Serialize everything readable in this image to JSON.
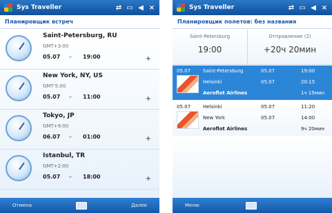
{
  "left": {
    "app_title": "Sys Traveller",
    "header": "Планировщик встреч",
    "cities": [
      {
        "name": "Saint-Petersburg, RU",
        "gmt": "GMT+3:00",
        "date": "05.07",
        "sep": "–",
        "time": "19:00",
        "action": "+"
      },
      {
        "name": "New York, NY, US",
        "gmt": "GMT-5:00",
        "date": "05.07",
        "sep": "–",
        "time": "11:00",
        "action": "+"
      },
      {
        "name": "Tokyo, JP",
        "gmt": "GMT+9:00",
        "date": "06.07",
        "sep": "–",
        "time": "01:00",
        "action": "+"
      },
      {
        "name": "Istanbul, TR",
        "gmt": "GMT+2:00",
        "date": "05.07",
        "sep": "–",
        "time": "18:00",
        "action": "+"
      }
    ],
    "menu": {
      "left": "Отмена",
      "right": "Далее"
    }
  },
  "right": {
    "app_title": "Sys Traveller",
    "header": "Планировщик полетов: без названия",
    "from": {
      "label": "Saint-Petersburg",
      "value": "19:00"
    },
    "to": {
      "label": "Отправление (2)",
      "value": "+20ч 20мин"
    },
    "flights": [
      {
        "selected": true,
        "date": "05.07",
        "legs": [
          {
            "city": "Saint-Petersburg",
            "date": "05.07",
            "time": "19:00"
          },
          {
            "city": "Helsinki",
            "date": "05.07",
            "time": "20:15"
          }
        ],
        "airline": "Aeroflot Airlines",
        "duration": "1ч 15мин"
      },
      {
        "selected": false,
        "date": "05.07",
        "legs": [
          {
            "city": "Helsinki",
            "date": "05.07",
            "time": "11:20"
          },
          {
            "city": "New York",
            "date": "05.07",
            "time": "14:00"
          }
        ],
        "airline": "Aeroflot Airlines",
        "duration": "9ч 20мин"
      }
    ],
    "menu": {
      "left": "Меню"
    }
  }
}
